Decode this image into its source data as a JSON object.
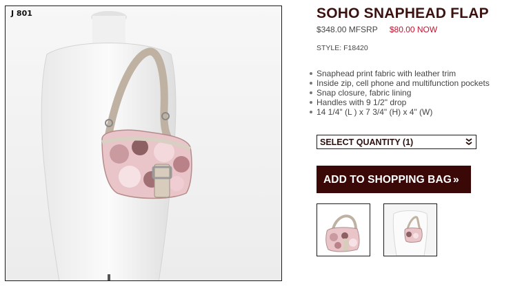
{
  "product": {
    "item_code": "J 801",
    "title": "SOHO SNAPHEAD FLAP",
    "price_original": "$348.00 MFSRP",
    "price_now": "$80.00 NOW",
    "style": "STYLE: F18420",
    "features": [
      "Snaphead print fabric with leather trim",
      "Inside zip, cell phone and multifunction pockets",
      "Snap closure, fabric lining",
      "Handles with 9 1/2\" drop",
      "14 1/4\" (L ) x 7 3/4\" (H) x 4\" (W)"
    ]
  },
  "quantity_select": {
    "selected": "SELECT QUANTITY (1)",
    "icon": "double-chevron-down-icon"
  },
  "add_to_bag": {
    "label": "ADD TO SHOPPING BAG",
    "arrow": "»"
  },
  "colors": {
    "title": "#3b1210",
    "price_now": "#c8102e",
    "button_bg": "#3b0808"
  }
}
